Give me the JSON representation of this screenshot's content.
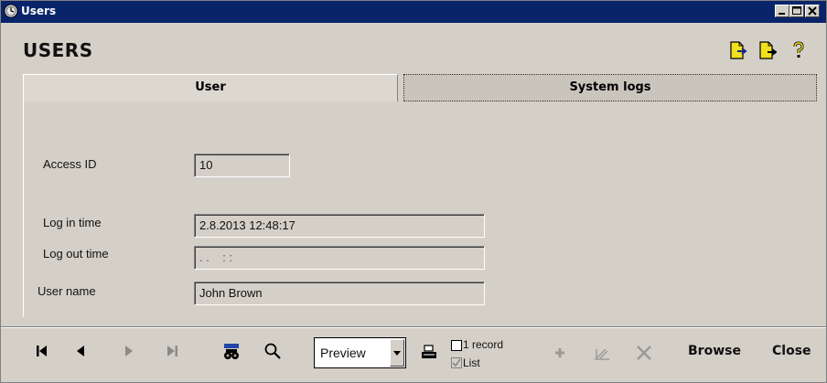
{
  "window": {
    "title": "Users"
  },
  "header": {
    "title": "USERS"
  },
  "tabs": [
    {
      "label": "User",
      "active": true
    },
    {
      "label": "System logs",
      "active": false
    }
  ],
  "form": {
    "access_id": {
      "label": "Access ID",
      "value": "10"
    },
    "log_in_time": {
      "label": "Log in time",
      "value": "2.8.2013 12:48:17"
    },
    "log_out_time": {
      "label": "Log out time",
      "value": ". .    : :"
    },
    "user_name": {
      "label": "User name",
      "value": "John Brown"
    }
  },
  "toolbar": {
    "output_select": {
      "value": "Preview"
    },
    "one_record": {
      "label": "1 record",
      "checked": false
    },
    "list": {
      "label": "List",
      "checked": true
    },
    "browse_label": "Browse",
    "close_label": "Close"
  },
  "icons": {
    "top": [
      "export-icon",
      "import-icon",
      "help-icon"
    ],
    "nav": [
      "first-record-icon",
      "previous-record-icon",
      "next-record-icon",
      "last-record-icon",
      "find-icon",
      "search-icon",
      "print-icon",
      "add-icon",
      "edit-icon",
      "delete-icon"
    ]
  },
  "colors": {
    "titlebar": "#0a246a",
    "face": "#d4d0c8",
    "accent_yellow": "#f0e020"
  }
}
